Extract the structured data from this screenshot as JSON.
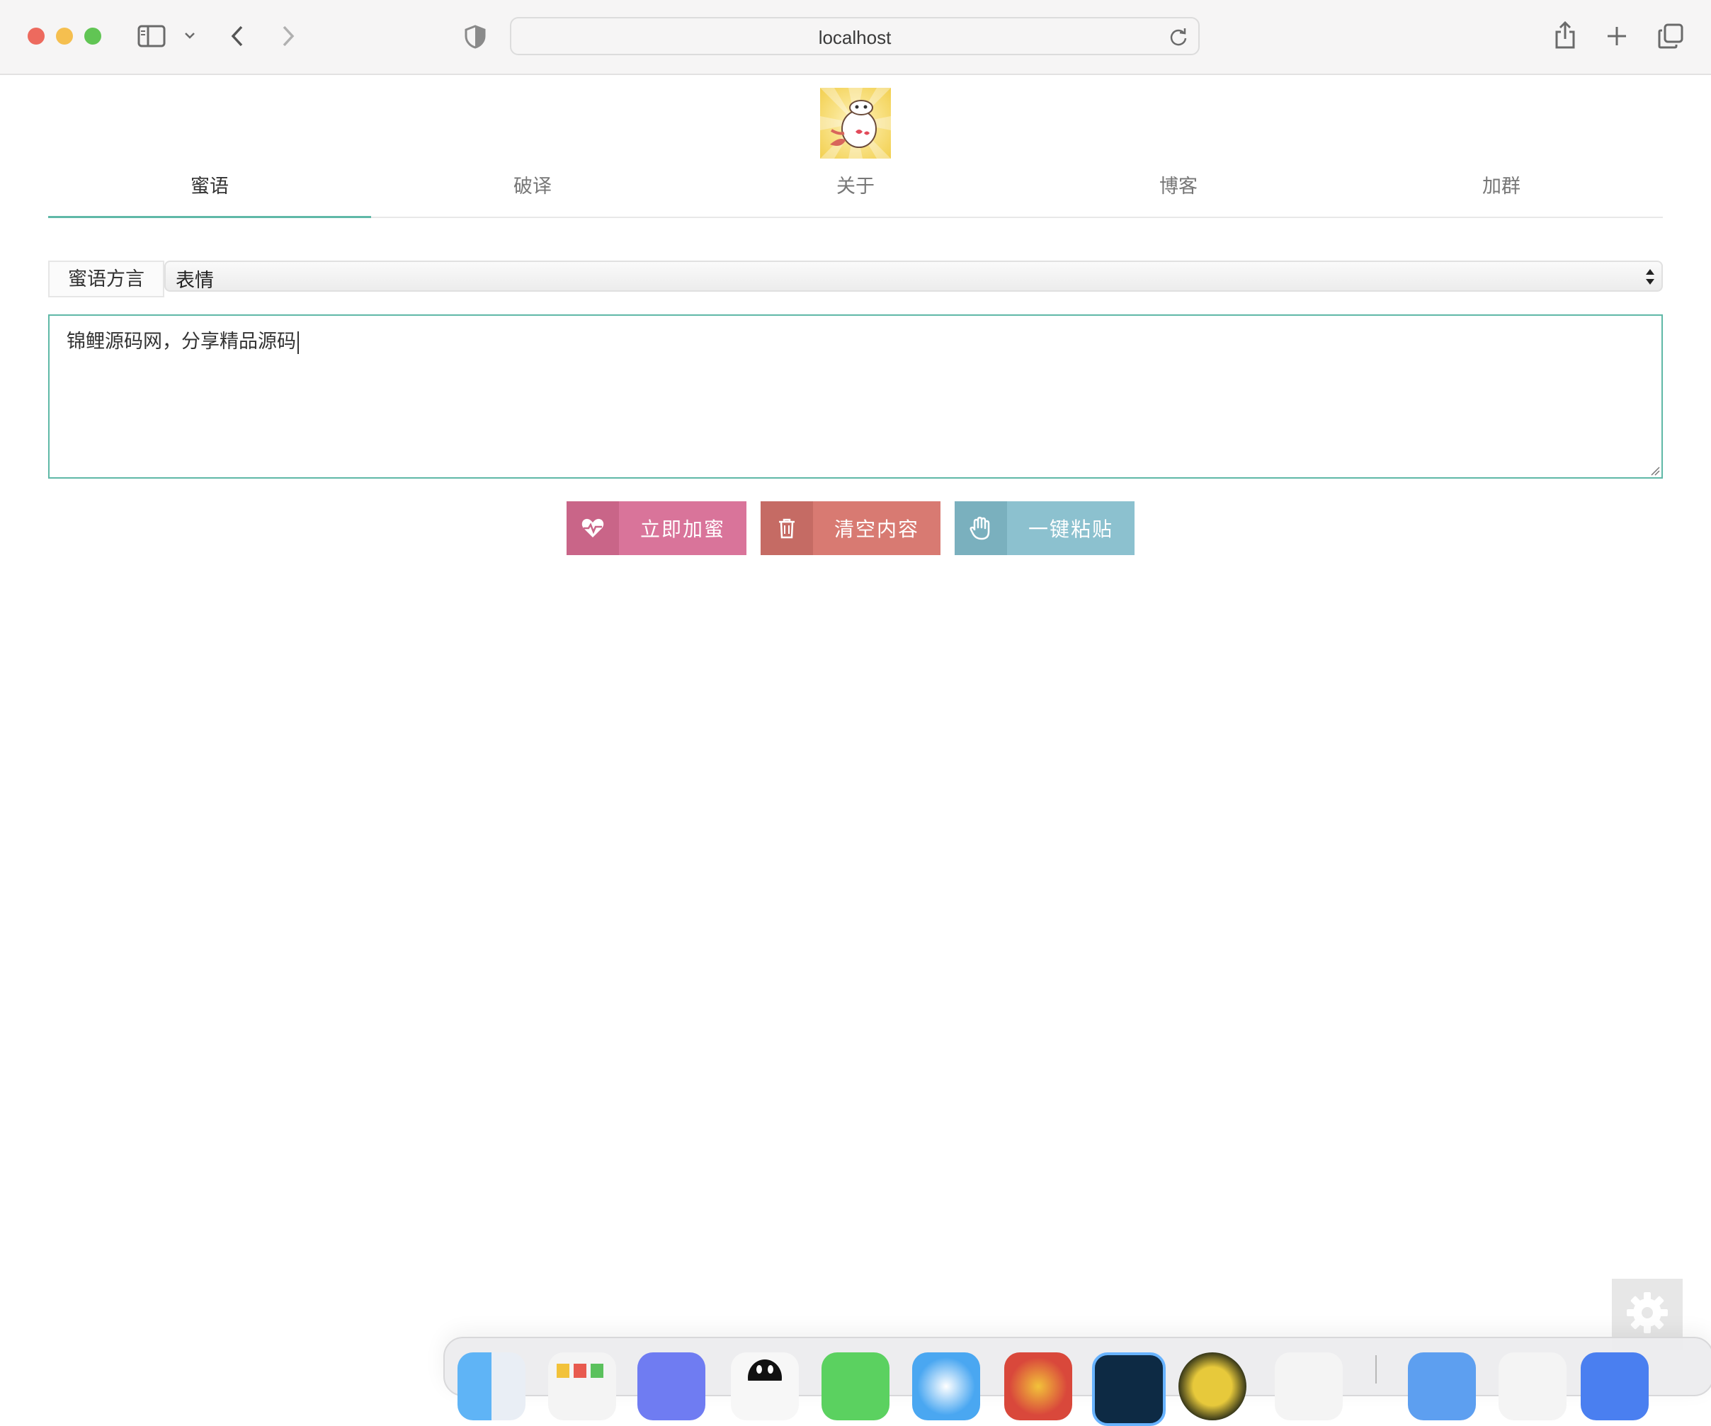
{
  "browser": {
    "address": "localhost"
  },
  "tabs": [
    {
      "label": "蜜语",
      "active": true
    },
    {
      "label": "破译",
      "active": false
    },
    {
      "label": "关于",
      "active": false
    },
    {
      "label": "博客",
      "active": false
    },
    {
      "label": "加群",
      "active": false
    }
  ],
  "dialect": {
    "label": "蜜语方言",
    "selected": "表情"
  },
  "input": {
    "value": "锦鲤源码网，分享精品源码"
  },
  "actions": {
    "encrypt_label": "立即加蜜",
    "clear_label": "清空内容",
    "paste_label": "一键粘贴"
  },
  "colors": {
    "accent": "#5fb8a7",
    "encrypt": "#d9749a",
    "clear": "#d87a72",
    "paste": "#8cc1cf"
  },
  "icons": {
    "encrypt": "heartbeat-icon",
    "clear": "trash-icon",
    "paste": "hand-icon",
    "settings": "gear-icon"
  },
  "dock_apps": [
    "finder",
    "launchpad",
    "dingtalk",
    "qq",
    "wechat",
    "safari",
    "chrome",
    "photoshop",
    "ultraedit",
    "maps",
    "telegram",
    "pen-tool",
    "word"
  ]
}
